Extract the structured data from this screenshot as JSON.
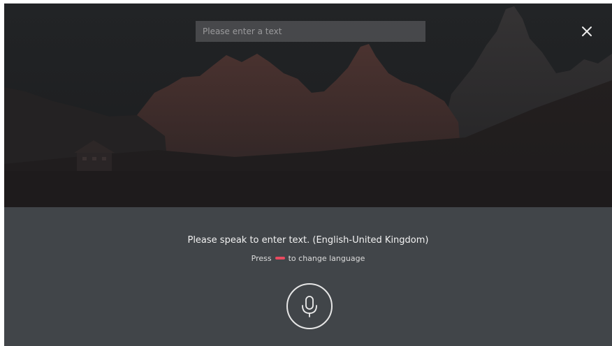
{
  "search": {
    "placeholder": "Please enter a text",
    "value": ""
  },
  "close_button": {
    "icon": "close-icon"
  },
  "voice_panel": {
    "prompt": "Please speak to enter text. (English-United Kingdom)",
    "hint_prefix": "Press",
    "hint_suffix": "to change language",
    "hint_key_color": "#e84a5f",
    "mic_icon": "microphone-icon"
  },
  "background": {
    "description_icon": "mountain-landscape-image"
  }
}
